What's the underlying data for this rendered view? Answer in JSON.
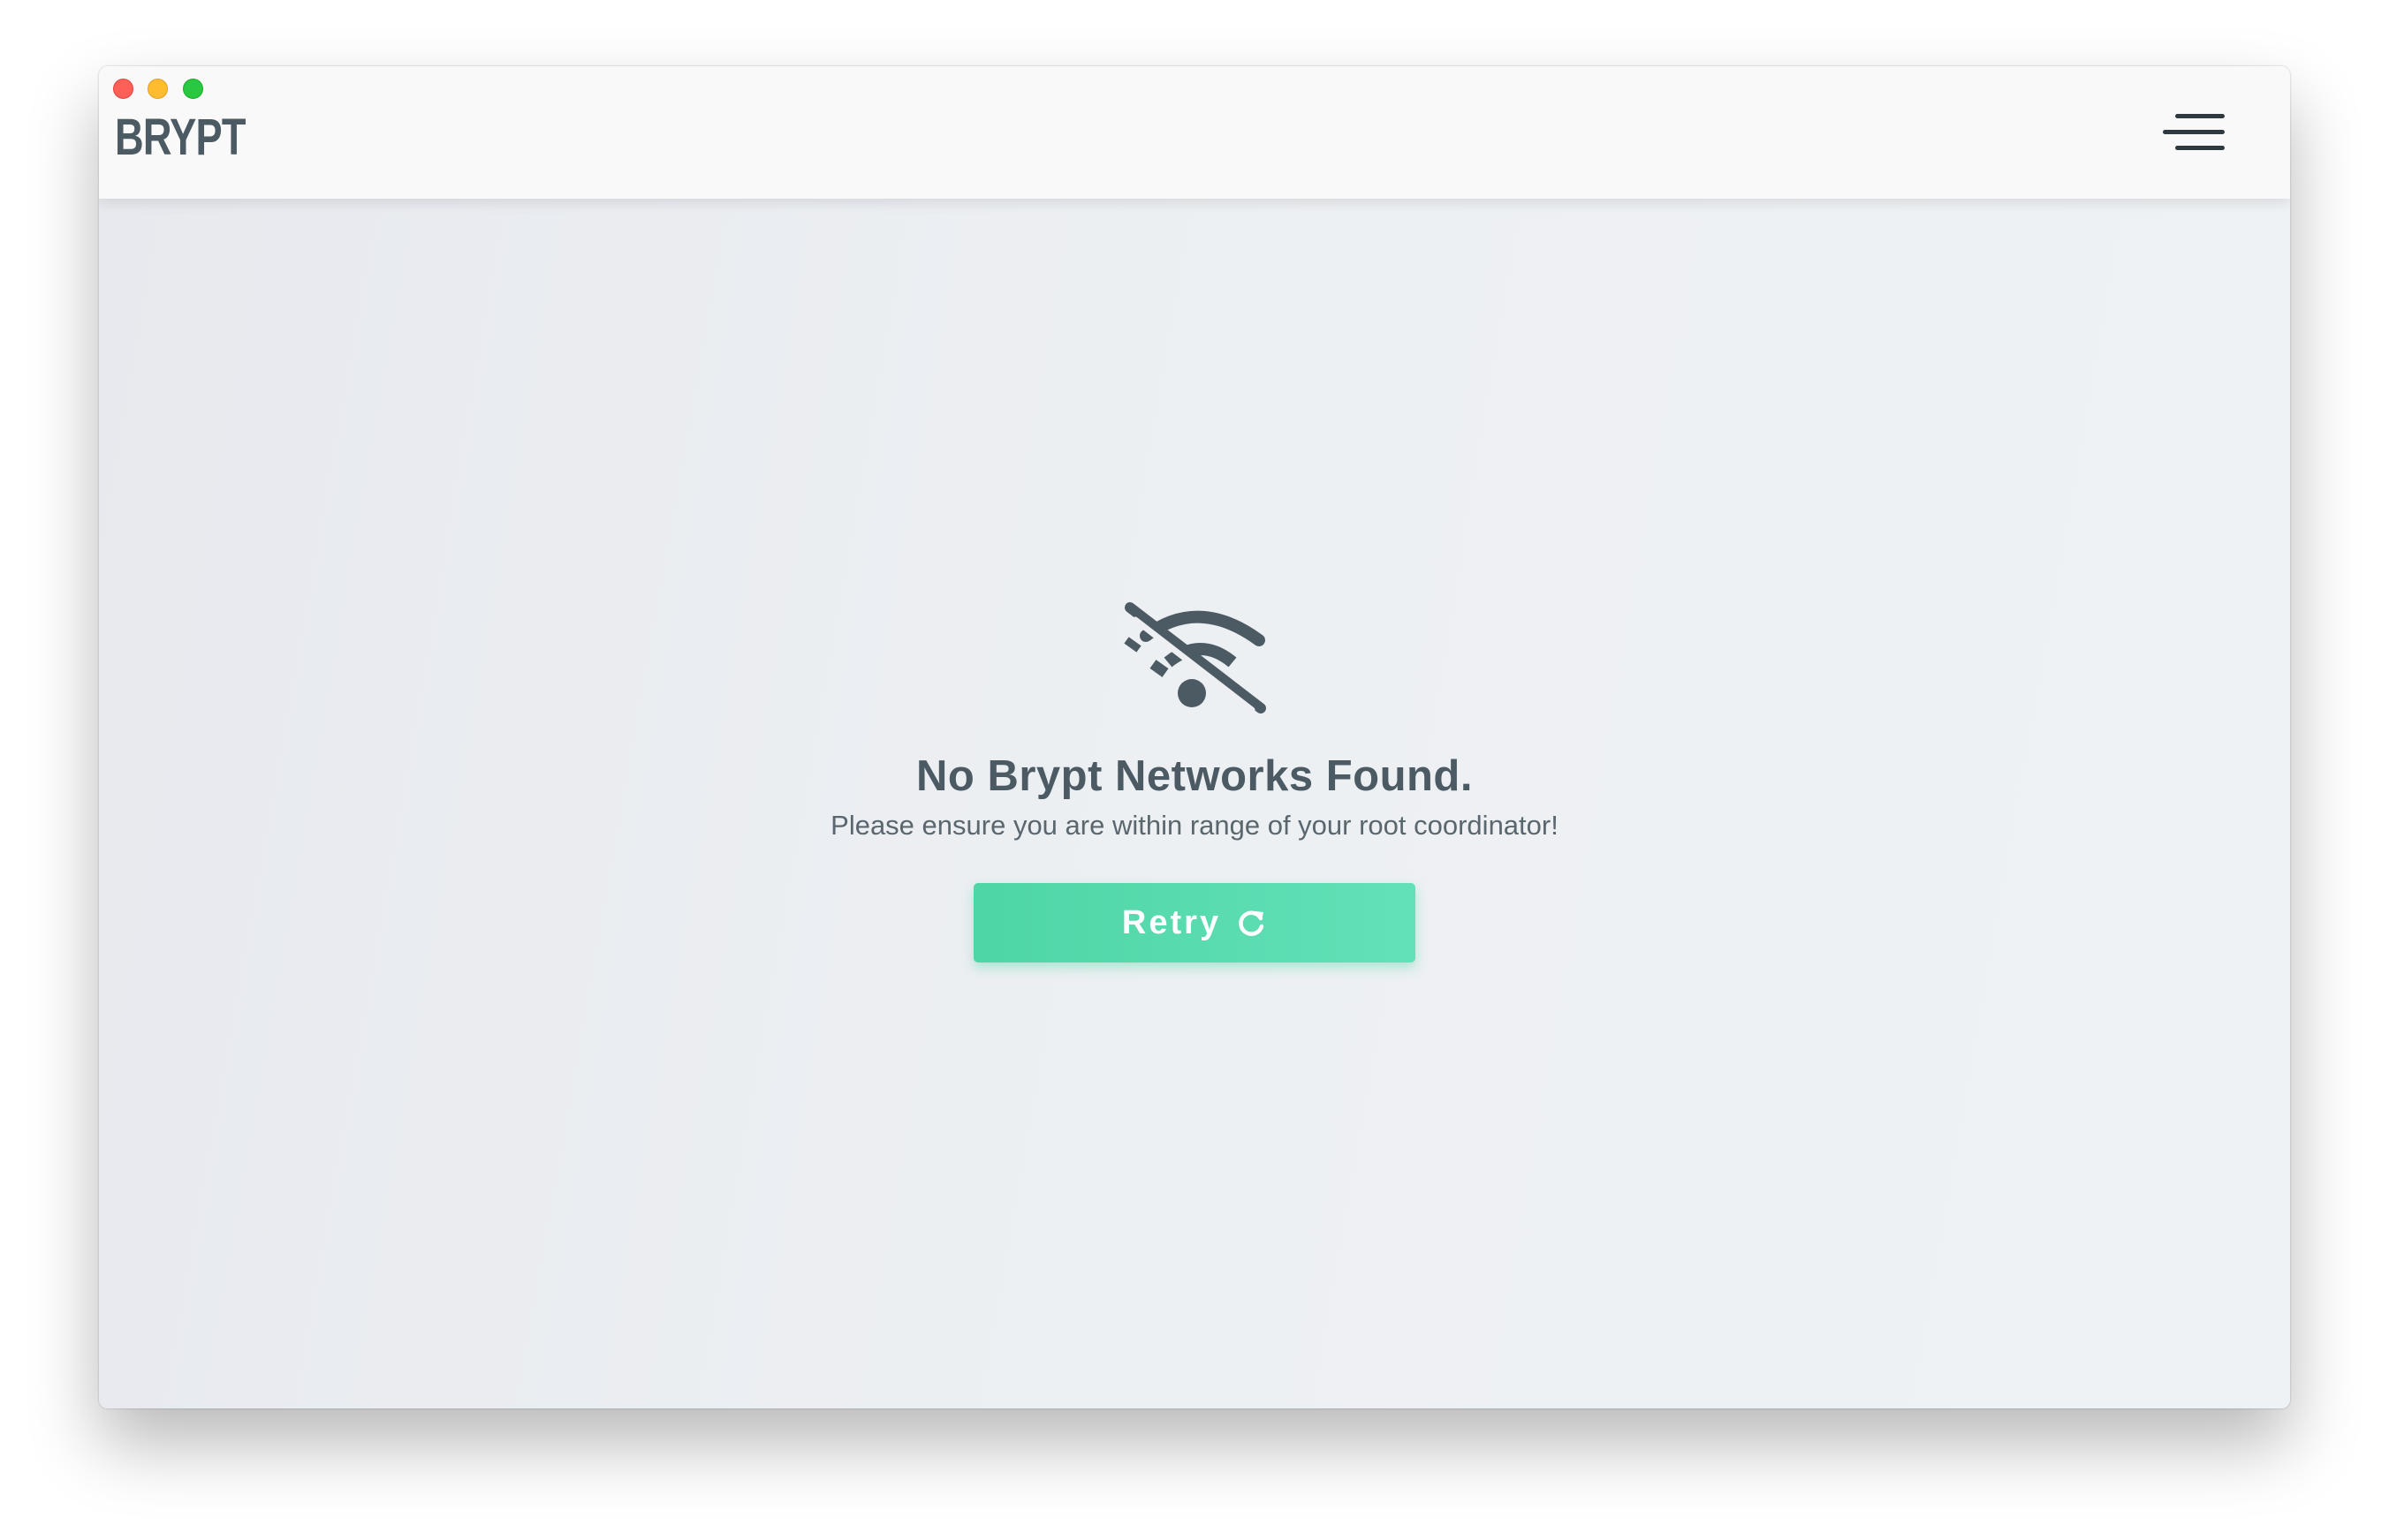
{
  "window": {
    "controls": [
      "close",
      "minimize",
      "zoom"
    ],
    "colors": {
      "close": "#fe5f57",
      "minimize": "#febc2e",
      "zoom": "#28c840"
    }
  },
  "header": {
    "logo_text": "BRYPT",
    "menu_icon": "hamburger-menu-icon"
  },
  "empty_state": {
    "icon": "wifi-off-icon",
    "title": "No Brypt Networks Found.",
    "message": "Please ensure you are within range of your root coordinator!",
    "retry_label": "Retry",
    "retry_icon": "refresh-icon"
  },
  "colors": {
    "accent": "#4ed6a6",
    "text_dark": "#4b5a63",
    "background": "#eceef2"
  }
}
